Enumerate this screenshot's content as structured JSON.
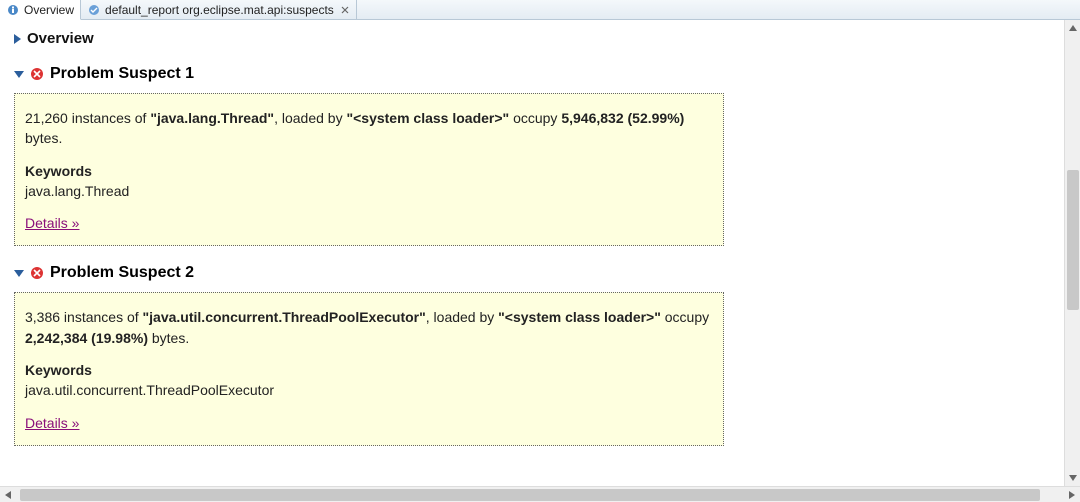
{
  "tabs": {
    "overview_label": "Overview",
    "report_label": "default_report  org.eclipse.mat.api:suspects"
  },
  "overview_section": {
    "title": "Overview"
  },
  "suspects": [
    {
      "title": "Problem Suspect 1",
      "body_prefix": "21,260 instances of ",
      "class_name": "\"java.lang.Thread\"",
      "body_mid": ", loaded by ",
      "loader": "\"<system class loader>\"",
      "body_after_loader": " occupy ",
      "bytes": "5,946,832 (52.99%)",
      "body_suffix": " bytes.",
      "keywords_label": "Keywords",
      "keywords_value": "java.lang.Thread",
      "details_label": "Details »"
    },
    {
      "title": "Problem Suspect 2",
      "body_prefix": "3,386 instances of ",
      "class_name": "\"java.util.concurrent.ThreadPoolExecutor\"",
      "body_mid": ", loaded by ",
      "loader": "\"<system class loader>\"",
      "body_after_loader": " occupy ",
      "bytes": "2,242,384 (19.98%)",
      "body_suffix": " bytes.",
      "keywords_label": "Keywords",
      "keywords_value": "java.util.concurrent.ThreadPoolExecutor",
      "details_label": "Details »"
    }
  ]
}
